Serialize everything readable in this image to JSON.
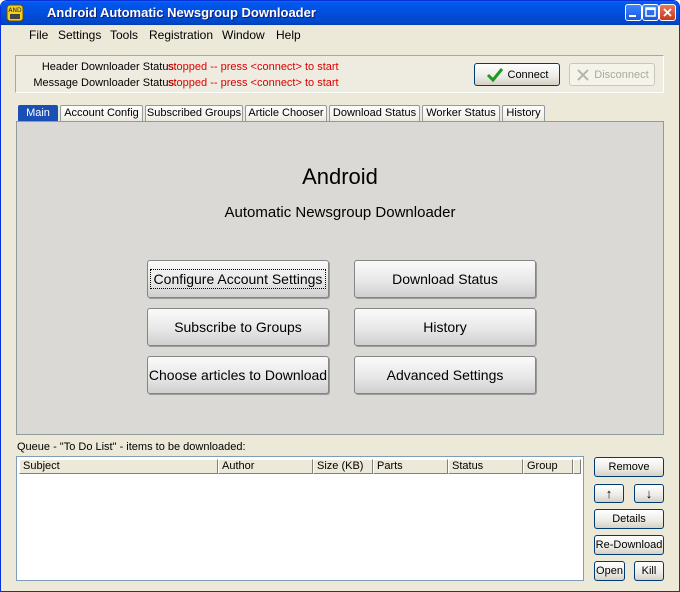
{
  "window": {
    "title": "Android Automatic Newsgroup Downloader"
  },
  "menu": {
    "items": [
      "File",
      "Settings",
      "Tools",
      "Registration",
      "Window",
      "Help"
    ]
  },
  "status": {
    "header_label": "Header Downloader Status:",
    "header_value": "stopped -- press <connect> to start",
    "message_label": "Message Downloader Status:",
    "message_value": "stopped -- press <connect> to start",
    "connect_label": "Connect",
    "disconnect_label": "Disconnect"
  },
  "tabs": [
    "Main",
    "Account Config",
    "Subscribed Groups",
    "Article Chooser",
    "Download Status",
    "Worker Status",
    "History"
  ],
  "main": {
    "title": "Android",
    "subtitle": "Automatic Newsgroup Downloader",
    "buttons": {
      "configure": "Configure Account Settings",
      "download_status": "Download Status",
      "subscribe": "Subscribe to Groups",
      "history": "History",
      "choose": "Choose articles to Download",
      "advanced": "Advanced Settings"
    }
  },
  "queue": {
    "label": "Queue - \"To Do List\" - items to be downloaded:",
    "columns": [
      "Subject",
      "Author",
      "Size (KB)",
      "Parts",
      "Status",
      "Group"
    ],
    "rows": []
  },
  "side_buttons": {
    "remove": "Remove",
    "up": "↑",
    "down": "↓",
    "details": "Details",
    "redownload": "Re-Download",
    "open": "Open",
    "kill": "Kill"
  },
  "colors": {
    "accent": "#1a4fb5",
    "status_text": "#e00000",
    "title_bar": "#0050e0"
  }
}
